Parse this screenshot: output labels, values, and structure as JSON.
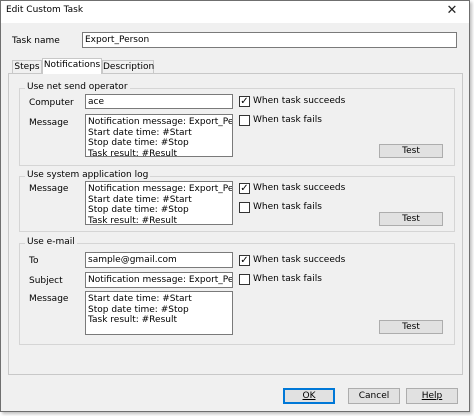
{
  "window": {
    "title": "Edit Custom Task",
    "close_glyph": "✕"
  },
  "task_name": {
    "label": "Task name",
    "value": "Export_Person"
  },
  "tabs": [
    {
      "label": "Steps",
      "active": false
    },
    {
      "label": "Notifications",
      "active": true
    },
    {
      "label": "Description",
      "active": false
    }
  ],
  "net_send": {
    "title": "Use net send operator",
    "computer_label": "Computer",
    "computer_value": "ace",
    "message_label": "Message",
    "message_lines": [
      "Notification message: Export_Person",
      "Start date time: #Start",
      "Stop date time: #Stop",
      "Task result: #Result"
    ],
    "when_succeeds": {
      "label": "When task succeeds",
      "checked": true
    },
    "when_fails": {
      "label": "When task fails",
      "checked": false
    },
    "test_label": "Test"
  },
  "app_log": {
    "title": "Use system application log",
    "message_label": "Message",
    "message_lines": [
      "Notification message: Export_Person",
      "Start date time: #Start",
      "Stop date time: #Stop",
      "Task result: #Result"
    ],
    "when_succeeds": {
      "label": "When task succeeds",
      "checked": true
    },
    "when_fails": {
      "label": "When task fails",
      "checked": false
    },
    "test_label": "Test"
  },
  "email": {
    "title": "Use e-mail",
    "to_label": "To",
    "to_value": "sample@gmail.com",
    "subject_label": "Subject",
    "subject_value": "Notification message: Export_Person",
    "message_label": "Message",
    "message_lines": [
      "Start date time: #Start",
      "Stop date time: #Stop",
      "Task result: #Result"
    ],
    "when_succeeds": {
      "label": "When task succeeds",
      "checked": true
    },
    "when_fails": {
      "label": "When task fails",
      "checked": false
    },
    "test_label": "Test"
  },
  "footer": {
    "ok_label": "OK",
    "cancel_label": "Cancel",
    "help_label": "Help"
  },
  "check_glyph": "✓"
}
